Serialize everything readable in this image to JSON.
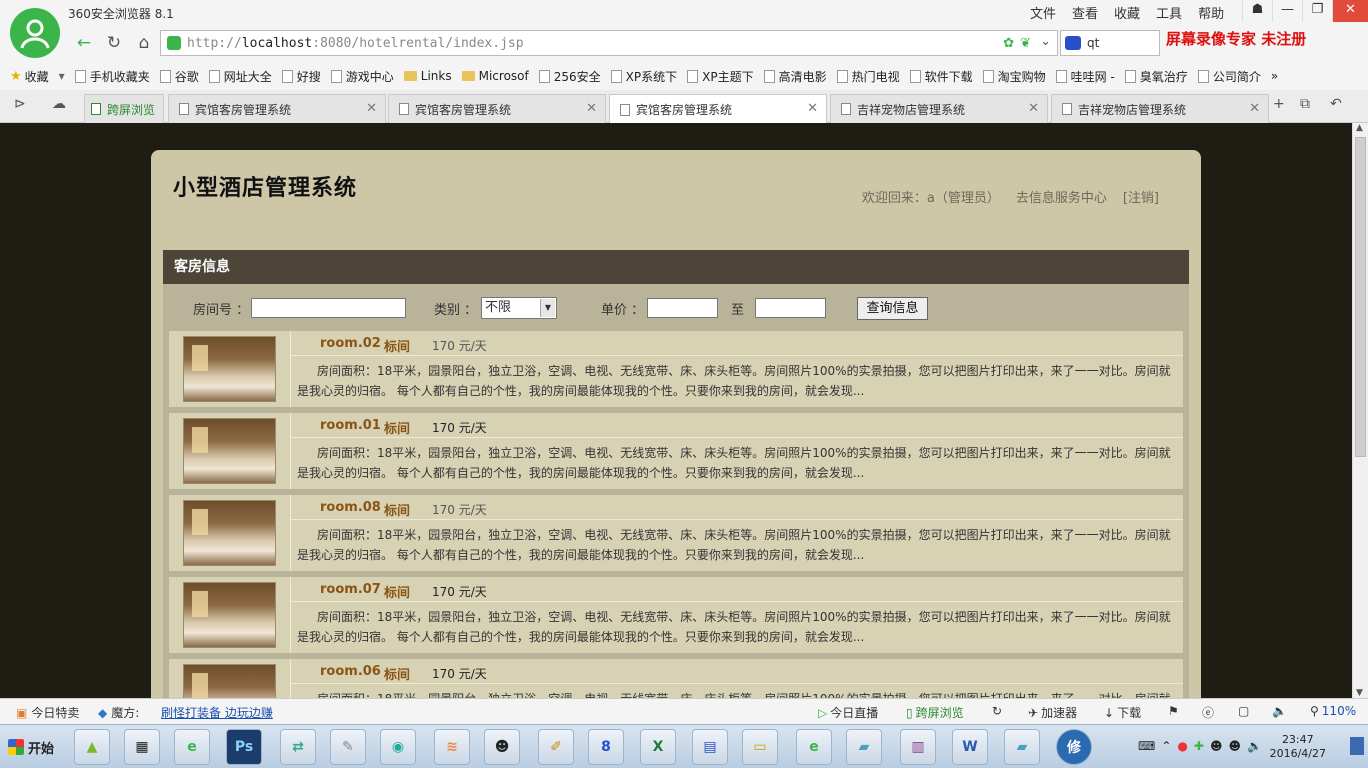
{
  "browser": {
    "title": "360安全浏览器 8.1",
    "menu": [
      "文件",
      "查看",
      "收藏",
      "工具",
      "帮助"
    ],
    "url_prefix": "http://",
    "url_host": "localhost",
    "url_rest": ":8080/hotelrental/index.jsp",
    "search_value": "qt",
    "watermark": "屏幕录像专家  未注册"
  },
  "bookmarks": [
    {
      "label": "收藏",
      "kind": "star"
    },
    {
      "label": "手机收藏夹",
      "kind": "page"
    },
    {
      "label": "谷歌",
      "kind": "page"
    },
    {
      "label": "网址大全",
      "kind": "page"
    },
    {
      "label": "好搜",
      "kind": "page"
    },
    {
      "label": "游戏中心",
      "kind": "page"
    },
    {
      "label": "Links",
      "kind": "folder"
    },
    {
      "label": "Microsof",
      "kind": "folder"
    },
    {
      "label": "256安全",
      "kind": "page"
    },
    {
      "label": "XP系统下",
      "kind": "page"
    },
    {
      "label": "XP主题下",
      "kind": "page"
    },
    {
      "label": "高清电影",
      "kind": "page"
    },
    {
      "label": "热门电视",
      "kind": "page"
    },
    {
      "label": "软件下载",
      "kind": "page"
    },
    {
      "label": "淘宝购物",
      "kind": "page"
    },
    {
      "label": "哇哇网 -",
      "kind": "page"
    },
    {
      "label": "臭氧治疗",
      "kind": "page"
    },
    {
      "label": "公司简介",
      "kind": "page"
    }
  ],
  "tabs": {
    "kuaping": "跨屏浏览",
    "items": [
      {
        "label": "宾馆客房管理系统",
        "active": false
      },
      {
        "label": "宾馆客房管理系统",
        "active": false
      },
      {
        "label": "宾馆客房管理系统",
        "active": true
      },
      {
        "label": "吉祥宠物店管理系统",
        "active": false
      },
      {
        "label": "吉祥宠物店管理系统",
        "active": false
      }
    ]
  },
  "site": {
    "title": "小型酒店管理系统",
    "welcome": "欢迎回来：a（管理员）",
    "service_link": "去信息服务中心",
    "logout": "[注销]",
    "section_title": "客房信息",
    "filter": {
      "room_label": "房间号 ：",
      "type_label": "类别 ：",
      "type_value": "不限",
      "price_label": "单价 ：",
      "to_label": "至",
      "search_btn": "查询信息"
    }
  },
  "rooms": [
    {
      "no": "room.02",
      "type": "标间",
      "price": "170 元/天",
      "dark": false
    },
    {
      "no": "room.01",
      "type": "标间",
      "price": "170 元/天",
      "dark": true
    },
    {
      "no": "room.08",
      "type": "标间",
      "price": "170 元/天",
      "dark": false
    },
    {
      "no": "room.07",
      "type": "标间",
      "price": "170 元/天",
      "dark": true
    },
    {
      "no": "room.06",
      "type": "标间",
      "price": "170 元/天",
      "dark": true
    }
  ],
  "room_desc": "房间面积：18平米，园景阳台，独立卫浴，空调、电视、无线宽带、床、床头柜等。房间照片100%的实景拍摄，您可以把图片打印出来，来了一一对比。房间就是我心灵的归宿。 每个人都有自己的个性，我的房间最能体现我的个性。只要你来到我的房间，就会发现...",
  "statusbar": {
    "today_sale": "今日特卖",
    "mofang": "魔方:",
    "mofang_link": "刷怪打装备 边玩边赚",
    "live": "今日直播",
    "kuaping": "跨屏浏览",
    "accel": "加速器",
    "download": "下载",
    "zoom": "110%"
  },
  "taskbar": {
    "start": "开始",
    "time": "23:47",
    "date": "2016/4/27"
  }
}
